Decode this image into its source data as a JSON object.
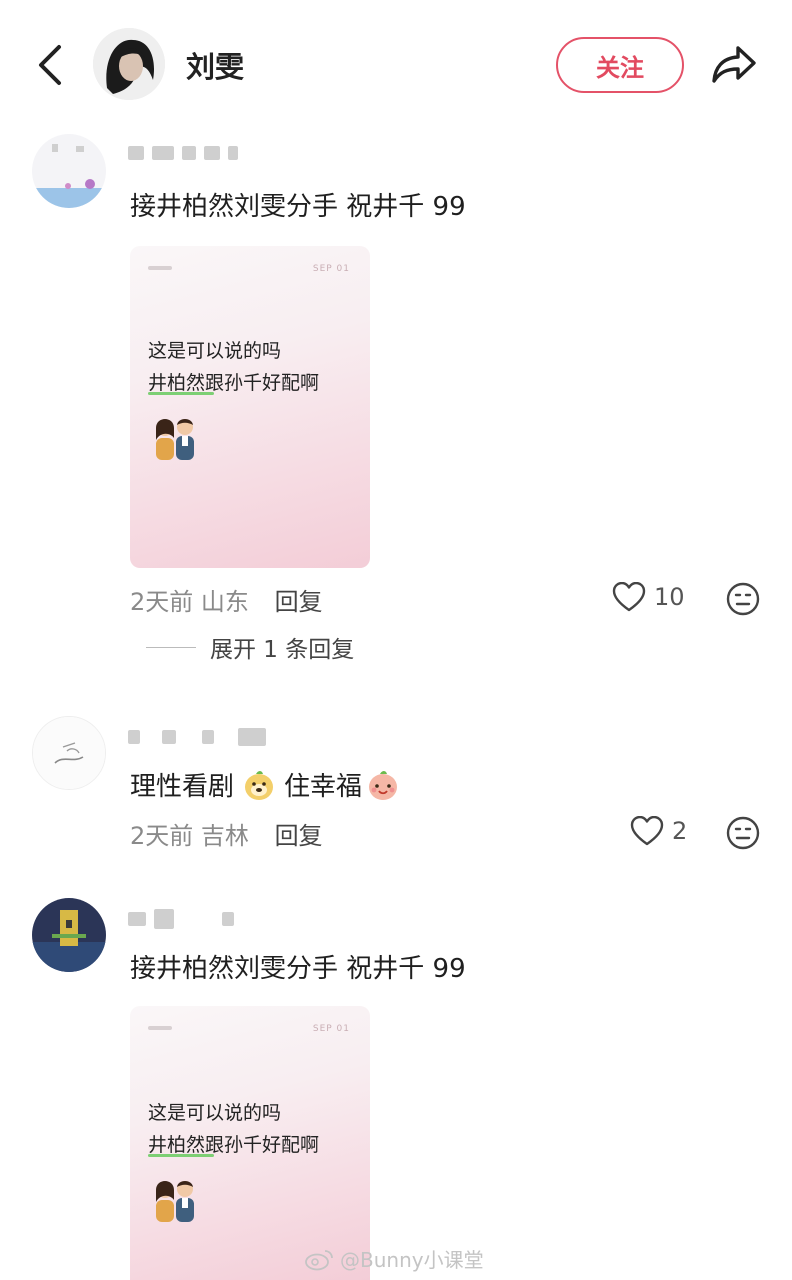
{
  "header": {
    "name": "刘雯",
    "follow_label": "关注"
  },
  "comments": [
    {
      "text": "接井柏然刘雯分手 祝井千 99",
      "card": {
        "line1": "这是可以说的吗",
        "line2": "井柏然跟孙千好配啊",
        "corner": "SEP 01"
      },
      "time": "2天前",
      "location": "山东",
      "reply_label": "回复",
      "likes": "10",
      "expand_label": "展开 1 条回复"
    },
    {
      "text_before": "理性看剧",
      "text_after": "住幸福",
      "time": "2天前",
      "location": "吉林",
      "reply_label": "回复",
      "likes": "2"
    },
    {
      "text": "接井柏然刘雯分手 祝井千 99",
      "card": {
        "line1": "这是可以说的吗",
        "line2": "井柏然跟孙千好配啊",
        "corner": "SEP 01"
      }
    }
  ],
  "watermark": "@Bunny小课堂",
  "colors": {
    "accent": "#e24a60",
    "muted": "#8a8a8a"
  }
}
